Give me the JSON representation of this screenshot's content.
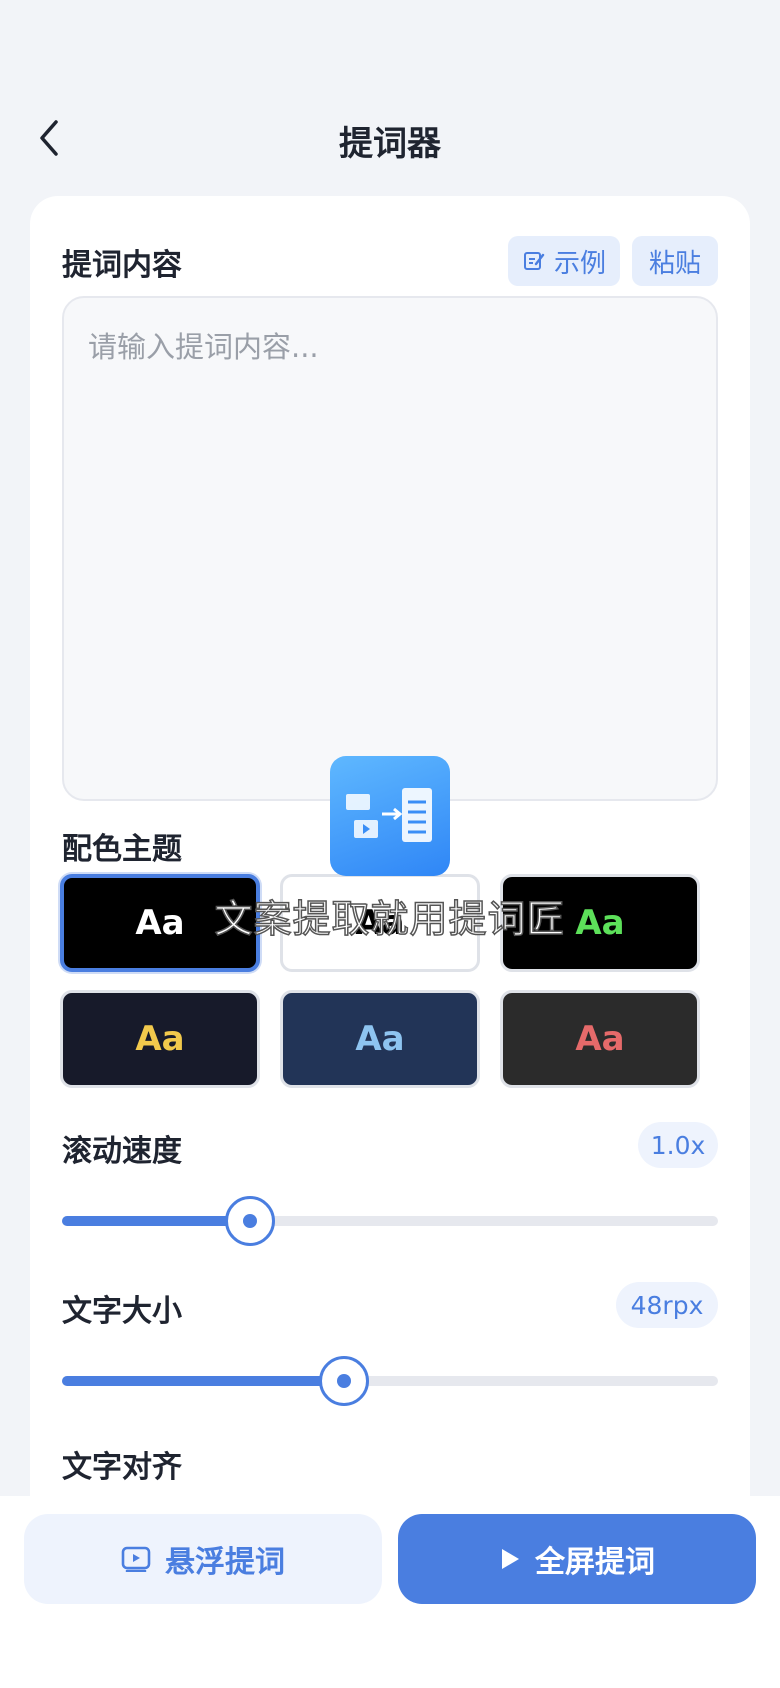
{
  "header": {
    "title": "提词器"
  },
  "content": {
    "section_title": "提词内容",
    "example_label": "示例",
    "paste_label": "粘贴",
    "placeholder": "请输入提词内容..."
  },
  "theme": {
    "section_title": "配色主题",
    "sample_text": "Aa",
    "selected_index": 0,
    "options": [
      {
        "bg": "#000000",
        "fg": "#ffffff"
      },
      {
        "bg": "#ffffff",
        "fg": "#000000"
      },
      {
        "bg": "#000000",
        "fg": "#5de05a"
      },
      {
        "bg": "#171a2a",
        "fg": "#f2c94c"
      },
      {
        "bg": "#223457",
        "fg": "#8ec4f0"
      },
      {
        "bg": "#2b2b2b",
        "fg": "#e56a6a"
      }
    ]
  },
  "speed": {
    "label": "滚动速度",
    "value": "1.0x",
    "fraction": 0.287
  },
  "font_size": {
    "label": "文字大小",
    "value": "48rpx",
    "fraction": 0.43
  },
  "align": {
    "label": "文字对齐"
  },
  "bottom": {
    "float_label": "悬浮提词",
    "fullscreen_label": "全屏提词"
  },
  "overlay": {
    "caption": "文案提取就用提词匠"
  },
  "colors": {
    "accent": "#4a7ee0",
    "accent_light": "#eef3fd"
  }
}
